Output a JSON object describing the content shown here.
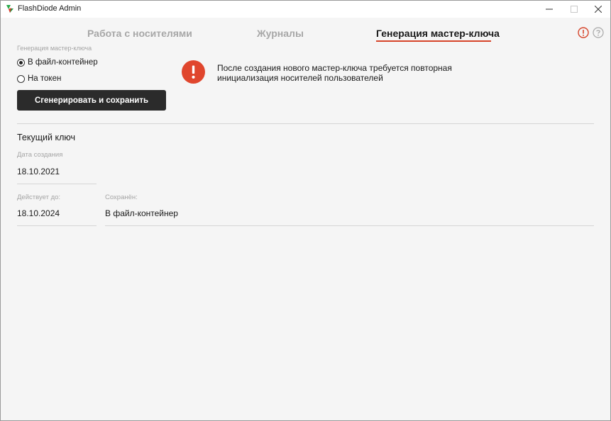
{
  "window": {
    "title": "FlashDiode Admin"
  },
  "tabs": [
    {
      "label": "Работа с носителями",
      "active": false
    },
    {
      "label": "Журналы",
      "active": false
    },
    {
      "label": "Генерация мастер-ключа",
      "active": true
    }
  ],
  "header_icons": {
    "info": "info-icon",
    "help": "help-icon"
  },
  "generation": {
    "section_label": "Генерация мастер-ключа",
    "options": [
      {
        "label": "В файл-контейнер",
        "checked": true
      },
      {
        "label": "На токен",
        "checked": false
      }
    ],
    "button_label": "Сгенерировать и сохранить"
  },
  "warning": {
    "line1": "После создания нового мастер-ключа требуется повторная",
    "line2": "инициализация носителей пользователей"
  },
  "current_key": {
    "title": "Текущий ключ",
    "created_label": "Дата создания",
    "created_value": "18.10.2021",
    "valid_label": "Действует до:",
    "valid_value": "18.10.2024",
    "saved_label": "Сохранён:",
    "saved_value": "В файл-контейнер"
  },
  "colors": {
    "accent": "#d6442a",
    "warning": "#e0462d",
    "button_bg": "#2b2b2b"
  }
}
